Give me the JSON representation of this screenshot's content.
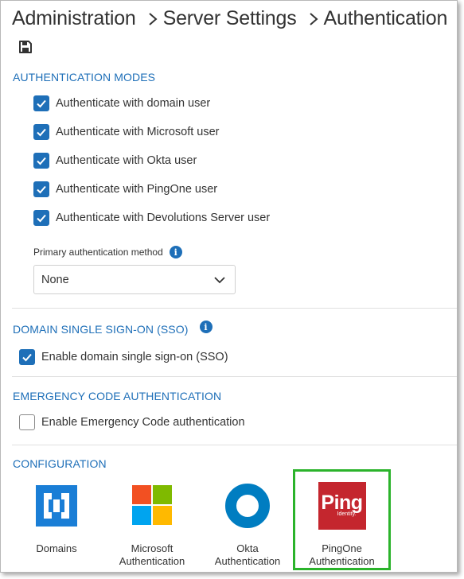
{
  "breadcrumb": [
    "Administration",
    "Server Settings",
    "Authentication"
  ],
  "toolbar": {
    "save_icon": "save-icon"
  },
  "auth_modes": {
    "title": "AUTHENTICATION MODES",
    "options": [
      {
        "label": "Authenticate with domain user",
        "checked": true
      },
      {
        "label": "Authenticate with Microsoft user",
        "checked": true
      },
      {
        "label": "Authenticate with Okta user",
        "checked": true
      },
      {
        "label": "Authenticate with PingOne user",
        "checked": true
      },
      {
        "label": "Authenticate with Devolutions Server user",
        "checked": true
      }
    ],
    "primary_label": "Primary authentication method",
    "primary_value": "None"
  },
  "sso": {
    "title": "DOMAIN SINGLE SIGN-ON (SSO)",
    "option": {
      "label": "Enable domain single sign-on (SSO)",
      "checked": true
    }
  },
  "emergency": {
    "title": "EMERGENCY CODE AUTHENTICATION",
    "option": {
      "label": "Enable Emergency Code authentication",
      "checked": false
    }
  },
  "configuration": {
    "title": "CONFIGURATION",
    "tiles": [
      {
        "line1": "",
        "line2": "Domains",
        "icon": "domains-icon"
      },
      {
        "line1": "Microsoft",
        "line2": "Authentication",
        "icon": "microsoft-logo-icon"
      },
      {
        "line1": "Okta",
        "line2": "Authentication",
        "icon": "okta-logo-icon"
      },
      {
        "line1": "PingOne",
        "line2": "Authentication",
        "icon": "ping-identity-logo-icon",
        "logo_text": "Ping",
        "logo_subtext": "Identity.",
        "selected": true
      }
    ]
  },
  "colors": {
    "accent": "#1e6fb8",
    "selected_outline": "#2bb32b",
    "ping_red": "#c4262e",
    "okta_blue": "#007dc1",
    "domains_blue": "#1a7ed6"
  }
}
